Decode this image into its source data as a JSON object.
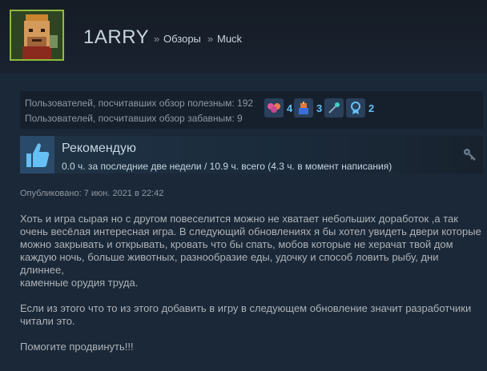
{
  "profile": {
    "username": "1ARRY",
    "breadcrumb": [
      {
        "sep": "»",
        "label": "Обзоры"
      },
      {
        "sep": "»",
        "label": "Muck"
      }
    ]
  },
  "stats": {
    "helpful": "Пользователей, посчитавших обзор полезным: 192",
    "funny": "Пользователей, посчитавших обзор забавным: 9"
  },
  "awards": [
    {
      "icon": "balloons-award-icon",
      "count": "4",
      "color": "#e0529c"
    },
    {
      "icon": "gift-award-icon",
      "count": "3",
      "color": "#e07a3a"
    },
    {
      "icon": "wand-award-icon",
      "count": "",
      "color": "#3fd0c5"
    },
    {
      "icon": "medal-award-icon",
      "count": "2",
      "color": "#66c0f4"
    }
  ],
  "recommendation": {
    "title": "Рекомендую",
    "hours": "0.0 ч. за последние две недели / 10.9 ч. всего (4.3 ч. в момент написания)"
  },
  "posted": "Опубликовано: 7 июн. 2021 в 22:42",
  "review": {
    "lines": [
      "Хоть и игра сырая но с другом повеселится можно не хватает небольших доработок ,а так",
      "очень весёлая интересная игра. В следующий обновлениях я бы хотел увидеть двери которые",
      "можно закрывать и открывать, кровать что бы спать, мобов которые не херачат твой дом",
      "каждую ночь, больше животных, разнообразие еды, удочку и способ ловить рыбу, дни",
      "длиннее,",
      "каменные орудия труда.",
      "",
      "Если из этого что то из этого добавить в игру в следующем обновление значит разработчики",
      "читали это.",
      "",
      "Помогите продвинуть!!!"
    ]
  },
  "colors": {
    "background": "#1b2838",
    "accent_blue": "#66c0f4",
    "text": "#c7d5e0",
    "muted": "#8f98a0",
    "avatar_border": "#90ba3c"
  }
}
